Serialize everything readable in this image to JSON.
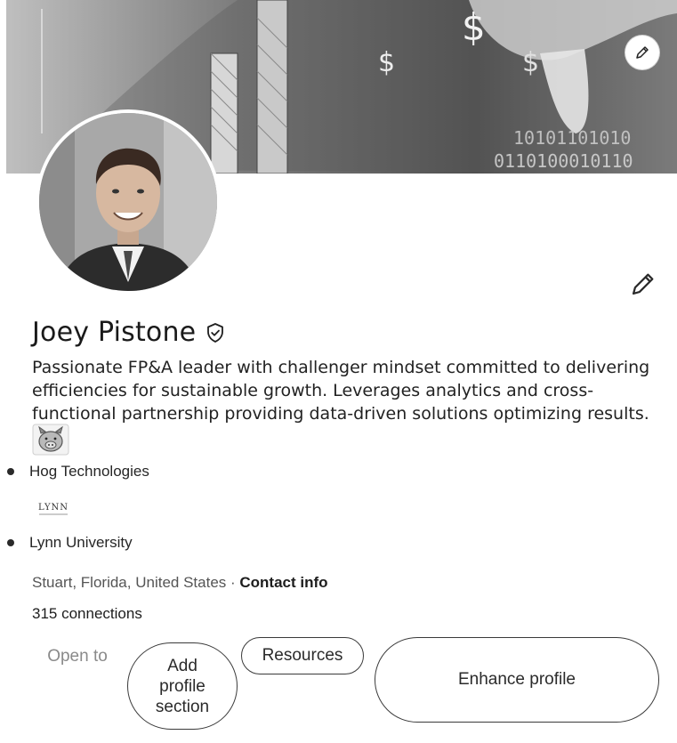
{
  "profile": {
    "name": "Joey Pistone",
    "headline": "Passionate FP&A leader with challenger mindset committed to delivering efficiencies for sustainable growth. Leverages analytics and cross-functional partnership providing data-driven solutions optimizing results.",
    "experience": [
      {
        "label": "Hog Technologies"
      },
      {
        "label": "Lynn University",
        "logo_text": "LYNN"
      }
    ],
    "location": "Stuart, Florida, United States",
    "location_separator": " · ",
    "contact_info_label": "Contact info",
    "connections": "315 connections"
  },
  "banner": {
    "dollar_signs": [
      "$",
      "$",
      "$"
    ],
    "binary_lines": [
      "10101101010",
      "0110100010110"
    ]
  },
  "actions": {
    "open_to": "Open to",
    "add_profile_section": "Add profile section",
    "resources": "Resources",
    "enhance_profile": "Enhance profile"
  },
  "icons": {
    "banner_edit": "pencil-icon",
    "profile_edit": "pencil-icon",
    "verified": "shield-check-icon"
  },
  "colors": {
    "text": "#1d1d1d",
    "muted": "#8a8a8a",
    "border": "#3a3a3a"
  }
}
